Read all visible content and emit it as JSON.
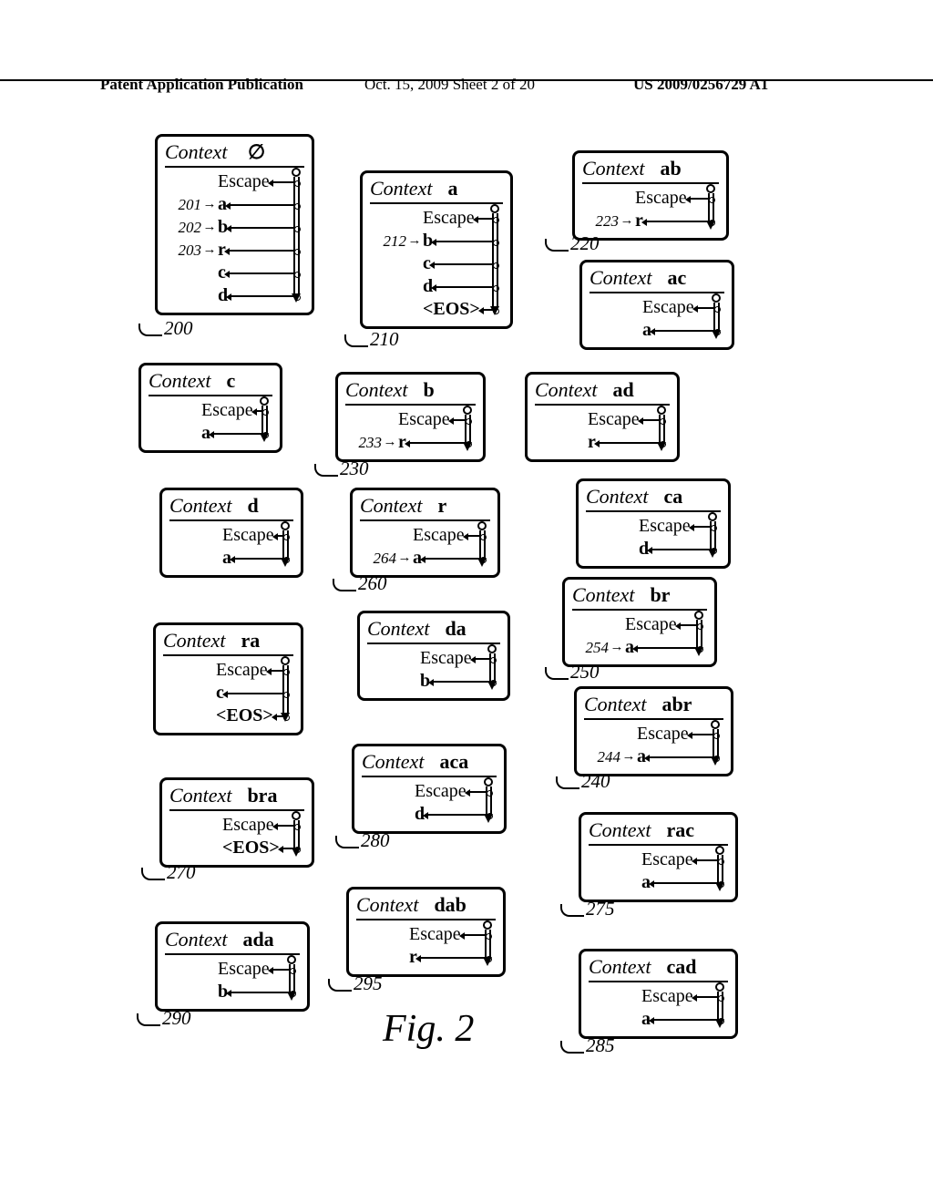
{
  "header": {
    "left": "Patent Application Publication",
    "mid": "Oct. 15, 2009  Sheet 2 of 20",
    "right": "US 2009/0256729 A1"
  },
  "figure_caption": "Fig. 2",
  "word_context": "Context",
  "word_escape": "Escape",
  "word_eos": "<EOS>",
  "ctx": {
    "c200": {
      "name": "∅",
      "ref": "200",
      "rows": [
        {
          "num": "201",
          "sym": "a"
        },
        {
          "num": "202",
          "sym": "b"
        },
        {
          "num": "203",
          "sym": "r"
        },
        {
          "num": "",
          "sym": "c"
        },
        {
          "num": "",
          "sym": "d"
        }
      ]
    },
    "c210": {
      "name": "a",
      "ref": "210",
      "rows": [
        {
          "num": "212",
          "sym": "b"
        },
        {
          "num": "",
          "sym": "c"
        },
        {
          "num": "",
          "sym": "d"
        },
        {
          "num": "",
          "sym": "<EOS>"
        }
      ]
    },
    "c220": {
      "name": "ab",
      "ref": "220",
      "rows": [
        {
          "num": "223",
          "sym": "r"
        }
      ]
    },
    "cAC": {
      "name": "ac",
      "ref": "",
      "rows": [
        {
          "num": "",
          "sym": "a"
        }
      ]
    },
    "cC": {
      "name": "c",
      "ref": "",
      "rows": [
        {
          "num": "",
          "sym": "a"
        }
      ]
    },
    "c230": {
      "name": "b",
      "ref": "230",
      "rows": [
        {
          "num": "233",
          "sym": "r"
        }
      ]
    },
    "cAD": {
      "name": "ad",
      "ref": "",
      "rows": [
        {
          "num": "",
          "sym": "r"
        }
      ]
    },
    "cD": {
      "name": "d",
      "ref": "",
      "rows": [
        {
          "num": "",
          "sym": "a"
        }
      ]
    },
    "c260": {
      "name": "r",
      "ref": "260",
      "rows": [
        {
          "num": "264",
          "sym": "a"
        }
      ]
    },
    "cCA": {
      "name": "ca",
      "ref": "",
      "rows": [
        {
          "num": "",
          "sym": "d"
        }
      ]
    },
    "cRA": {
      "name": "ra",
      "ref": "",
      "rows": [
        {
          "num": "",
          "sym": "c"
        },
        {
          "num": "",
          "sym": "<EOS>"
        }
      ]
    },
    "cDA": {
      "name": "da",
      "ref": "",
      "rows": [
        {
          "num": "",
          "sym": "b"
        }
      ]
    },
    "c250": {
      "name": "br",
      "ref": "250",
      "rows": [
        {
          "num": "254",
          "sym": "a"
        }
      ]
    },
    "c240": {
      "name": "abr",
      "ref": "240",
      "rows": [
        {
          "num": "244",
          "sym": "a"
        }
      ]
    },
    "c270": {
      "name": "bra",
      "ref": "270",
      "rows": [
        {
          "num": "",
          "sym": "<EOS>"
        }
      ]
    },
    "c280": {
      "name": "aca",
      "ref": "280",
      "rows": [
        {
          "num": "",
          "sym": "d"
        }
      ]
    },
    "c275": {
      "name": "rac",
      "ref": "275",
      "rows": [
        {
          "num": "",
          "sym": "a"
        }
      ]
    },
    "c290": {
      "name": "ada",
      "ref": "290",
      "rows": [
        {
          "num": "",
          "sym": "b"
        }
      ]
    },
    "c295": {
      "name": "dab",
      "ref": "295",
      "rows": [
        {
          "num": "",
          "sym": "r"
        }
      ]
    },
    "c285": {
      "name": "cad",
      "ref": "285",
      "rows": [
        {
          "num": "",
          "sym": "a"
        }
      ]
    }
  },
  "chart_data": {
    "type": "table",
    "description": "PPM-style context tables produced after encoding a sample string; each box lists a context string and the symbols (with Escape) seen in that context. A vertical pin icon at the right of each box represents the probability range bar.",
    "escape_symbol": "Escape",
    "eos_symbol": "<EOS>",
    "contexts": [
      {
        "id": 200,
        "context": "",
        "symbols": [
          "Escape",
          "a",
          "b",
          "r",
          "c",
          "d"
        ],
        "row_refs": {
          "a": 201,
          "b": 202,
          "r": 203
        }
      },
      {
        "id": 210,
        "context": "a",
        "symbols": [
          "Escape",
          "b",
          "c",
          "d",
          "<EOS>"
        ],
        "row_refs": {
          "b": 212
        }
      },
      {
        "id": 220,
        "context": "ab",
        "symbols": [
          "Escape",
          "r"
        ],
        "row_refs": {
          "r": 223
        }
      },
      {
        "id": null,
        "context": "ac",
        "symbols": [
          "Escape",
          "a"
        ]
      },
      {
        "id": null,
        "context": "c",
        "symbols": [
          "Escape",
          "a"
        ]
      },
      {
        "id": 230,
        "context": "b",
        "symbols": [
          "Escape",
          "r"
        ],
        "row_refs": {
          "r": 233
        }
      },
      {
        "id": null,
        "context": "ad",
        "symbols": [
          "Escape",
          "r"
        ]
      },
      {
        "id": null,
        "context": "d",
        "symbols": [
          "Escape",
          "a"
        ]
      },
      {
        "id": 260,
        "context": "r",
        "symbols": [
          "Escape",
          "a"
        ],
        "row_refs": {
          "a": 264
        }
      },
      {
        "id": null,
        "context": "ca",
        "symbols": [
          "Escape",
          "d"
        ]
      },
      {
        "id": null,
        "context": "ra",
        "symbols": [
          "Escape",
          "c",
          "<EOS>"
        ]
      },
      {
        "id": null,
        "context": "da",
        "symbols": [
          "Escape",
          "b"
        ]
      },
      {
        "id": 250,
        "context": "br",
        "symbols": [
          "Escape",
          "a"
        ],
        "row_refs": {
          "a": 254
        }
      },
      {
        "id": 240,
        "context": "abr",
        "symbols": [
          "Escape",
          "a"
        ],
        "row_refs": {
          "a": 244
        }
      },
      {
        "id": 270,
        "context": "bra",
        "symbols": [
          "Escape",
          "<EOS>"
        ]
      },
      {
        "id": 280,
        "context": "aca",
        "symbols": [
          "Escape",
          "d"
        ]
      },
      {
        "id": 275,
        "context": "rac",
        "symbols": [
          "Escape",
          "a"
        ]
      },
      {
        "id": 290,
        "context": "ada",
        "symbols": [
          "Escape",
          "b"
        ]
      },
      {
        "id": 295,
        "context": "dab",
        "symbols": [
          "Escape",
          "r"
        ]
      },
      {
        "id": 285,
        "context": "cad",
        "symbols": [
          "Escape",
          "a"
        ]
      }
    ]
  }
}
